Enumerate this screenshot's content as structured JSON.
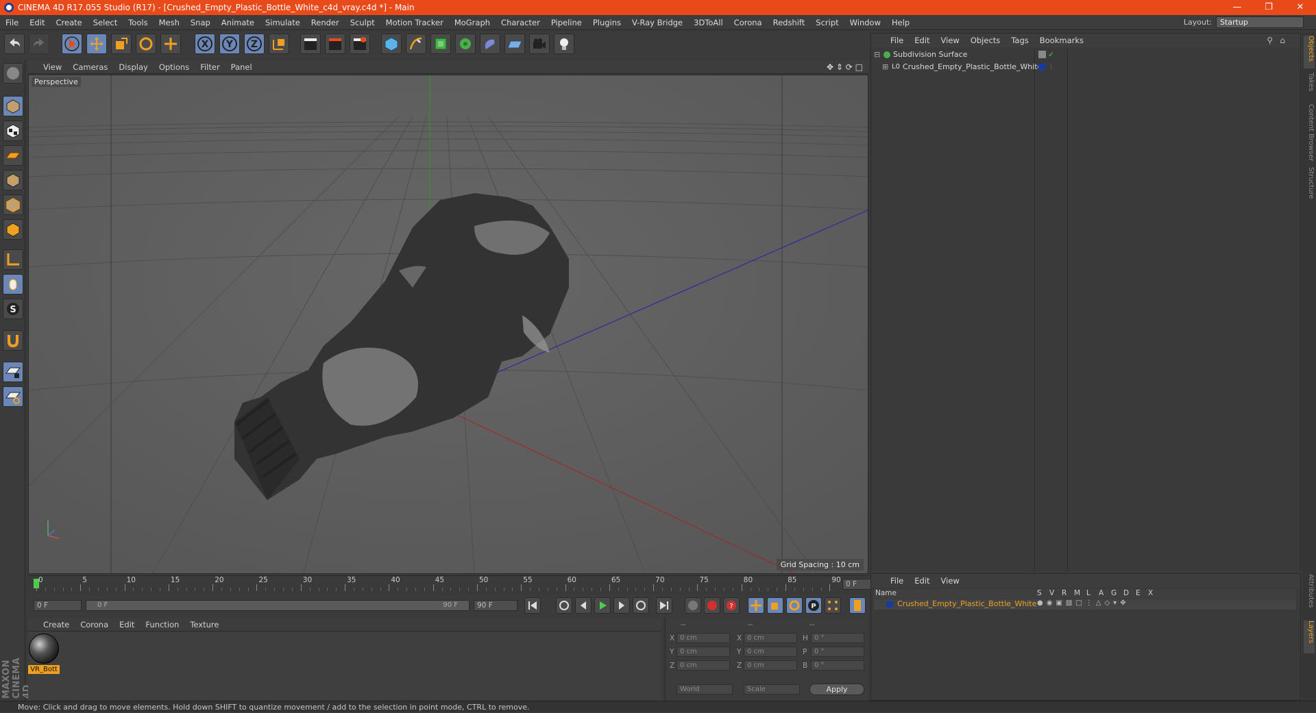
{
  "window": {
    "title": "CINEMA 4D R17.055 Studio (R17) - [Crushed_Empty_Plastic_Bottle_White_c4d_vray.c4d *] - Main",
    "minimize_icon": "minimize-icon",
    "maximize_icon": "restore-icon",
    "close_icon": "close-icon"
  },
  "menubar": {
    "items": [
      "File",
      "Edit",
      "Create",
      "Select",
      "Tools",
      "Mesh",
      "Snap",
      "Animate",
      "Simulate",
      "Render",
      "Sculpt",
      "Motion Tracker",
      "MoGraph",
      "Character",
      "Pipeline",
      "Plugins",
      "V-Ray Bridge",
      "3DToAll",
      "Corona",
      "Redshift",
      "Script",
      "Window",
      "Help"
    ],
    "layout_label": "Layout:",
    "layout_value": "Startup"
  },
  "viewport": {
    "menu": [
      "View",
      "Cameras",
      "Display",
      "Options",
      "Filter",
      "Panel"
    ],
    "camera_label": "Perspective",
    "grid_spacing": "Grid Spacing : 10 cm"
  },
  "timeline": {
    "ticks": [
      "0",
      "5",
      "10",
      "15",
      "20",
      "25",
      "30",
      "35",
      "40",
      "45",
      "50",
      "55",
      "60",
      "65",
      "70",
      "75",
      "80",
      "85",
      "90"
    ],
    "current_frame_display": "0 F",
    "start_frame": "0 F",
    "range_start": "0 F",
    "range_end": "90 F",
    "end_frame": "90 F"
  },
  "material_manager": {
    "menu": [
      "Create",
      "Corona",
      "Edit",
      "Function",
      "Texture"
    ],
    "material_name": "VR_Bott"
  },
  "coordinates": {
    "headers": [
      "--",
      "--",
      "--"
    ],
    "rows": [
      {
        "pos_label": "X",
        "pos": "0 cm",
        "size_label": "X",
        "size": "0 cm",
        "rot_label": "H",
        "rot": "0 °"
      },
      {
        "pos_label": "Y",
        "pos": "0 cm",
        "size_label": "Y",
        "size": "0 cm",
        "rot_label": "P",
        "rot": "0 °"
      },
      {
        "pos_label": "Z",
        "pos": "0 cm",
        "size_label": "Z",
        "size": "0 cm",
        "rot_label": "B",
        "rot": "0 °"
      }
    ],
    "space": "World",
    "mode": "Scale",
    "apply": "Apply"
  },
  "object_manager": {
    "menu": [
      "File",
      "Edit",
      "View",
      "Objects",
      "Tags",
      "Bookmarks"
    ],
    "objects": [
      {
        "name": "Subdivision Surface"
      },
      {
        "name": "Crushed_Empty_Plastic_Bottle_White"
      }
    ]
  },
  "layer_manager": {
    "menu": [
      "File",
      "Edit",
      "View"
    ],
    "columns": [
      "Name",
      "S",
      "V",
      "R",
      "M",
      "L",
      "A",
      "G",
      "D",
      "E",
      "X"
    ],
    "layers": [
      {
        "name": "Crushed_Empty_Plastic_Bottle_White",
        "color": "#1a3aa0"
      }
    ]
  },
  "right_tabs": [
    "Objects",
    "Takes",
    "Content Browser",
    "Structure"
  ],
  "right_tabs_bottom": [
    "Attributes",
    "Layers"
  ],
  "status": "Move: Click and drag to move elements. Hold down SHIFT to quantize movement / add to the selection in point mode, CTRL to remove.",
  "brand": "MAXON CINEMA 4D",
  "colors": {
    "titlebar": "#e84a1a",
    "accent": "#f0a020",
    "active_tool": "#6b87b7"
  }
}
